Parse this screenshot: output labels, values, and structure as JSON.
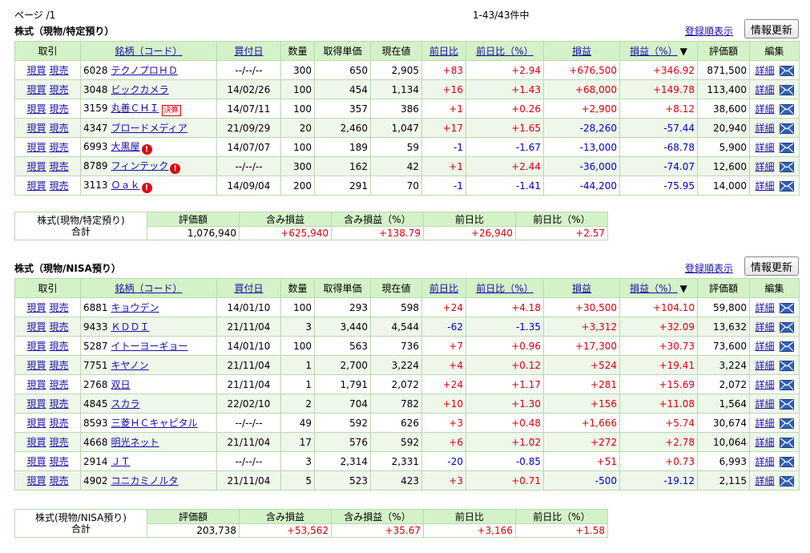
{
  "page_label": "ページ /1",
  "count_label": "1-43/43件中",
  "headers": [
    "取引",
    "銘柄（コード）",
    "買付日",
    "数量",
    "取得単価",
    "現在値",
    "前日比",
    "前日比（%）",
    "損益",
    "損益（%）",
    "評価額",
    "編集"
  ],
  "sort_mark": "▼",
  "sort_order_link": "登録順表示",
  "refresh_label": "情報更新",
  "buy_label": "現買",
  "sell_label": "現売",
  "detail_label": "詳細",
  "kessan_label": "決算",
  "warn_glyph": "!",
  "summary_headers": [
    "評価額",
    "含み損益",
    "含み損益（%）",
    "前日比",
    "前日比（%）"
  ],
  "colors": {
    "header_bg": "#d4f2c7",
    "border": "#b9d9b0",
    "even_row": "#eef7ea",
    "positive": "#e0000b",
    "negative": "#0000cc",
    "link": "#1a0dab"
  },
  "sections": [
    {
      "title": "株式（現物/特定預り）",
      "summary_label": "株式(現物/特定預り)",
      "summary_total_label": "合計",
      "summary_values": [
        "1,076,940",
        "+625,940",
        "+138.79",
        "+26,940",
        "+2.57"
      ],
      "rows": [
        {
          "code": "6028",
          "name": "テクノプロＨＤ",
          "date": "--/--/--",
          "qty": "300",
          "cost": "650",
          "price": "2,905",
          "chg": "+83",
          "chg_pct": "+2.94",
          "pl": "+676,500",
          "pl_pct": "+346.92",
          "value": "871,500",
          "warn": false,
          "kessan": false
        },
        {
          "code": "3048",
          "name": "ビックカメラ",
          "date": "14/02/26",
          "qty": "100",
          "cost": "454",
          "price": "1,134",
          "chg": "+16",
          "chg_pct": "+1.43",
          "pl": "+68,000",
          "pl_pct": "+149.78",
          "value": "113,400",
          "warn": false,
          "kessan": false
        },
        {
          "code": "3159",
          "name": "丸善ＣＨＩ",
          "date": "14/07/11",
          "qty": "100",
          "cost": "357",
          "price": "386",
          "chg": "+1",
          "chg_pct": "+0.26",
          "pl": "+2,900",
          "pl_pct": "+8.12",
          "value": "38,600",
          "warn": false,
          "kessan": true
        },
        {
          "code": "4347",
          "name": "ブロードメディア",
          "date": "21/09/29",
          "qty": "20",
          "cost": "2,460",
          "price": "1,047",
          "chg": "+17",
          "chg_pct": "+1.65",
          "pl": "-28,260",
          "pl_pct": "-57.44",
          "value": "20,940",
          "warn": false,
          "kessan": false
        },
        {
          "code": "6993",
          "name": "大黒屋",
          "date": "14/07/07",
          "qty": "100",
          "cost": "189",
          "price": "59",
          "chg": "-1",
          "chg_pct": "-1.67",
          "pl": "-13,000",
          "pl_pct": "-68.78",
          "value": "5,900",
          "warn": true,
          "kessan": false
        },
        {
          "code": "8789",
          "name": "フィンテック",
          "date": "--/--/--",
          "qty": "300",
          "cost": "162",
          "price": "42",
          "chg": "+1",
          "chg_pct": "+2.44",
          "pl": "-36,000",
          "pl_pct": "-74.07",
          "value": "12,600",
          "warn": true,
          "kessan": false
        },
        {
          "code": "3113",
          "name": "Ｏａｋ",
          "date": "14/09/04",
          "qty": "200",
          "cost": "291",
          "price": "70",
          "chg": "-1",
          "chg_pct": "-1.41",
          "pl": "-44,200",
          "pl_pct": "-75.95",
          "value": "14,000",
          "warn": true,
          "kessan": false
        }
      ]
    },
    {
      "title": "株式（現物/NISA預り）",
      "summary_label": "株式(現物/NISA預り)",
      "summary_total_label": "合計",
      "summary_values": [
        "203,738",
        "+53,562",
        "+35.67",
        "+3,166",
        "+1.58"
      ],
      "rows": [
        {
          "code": "6881",
          "name": "キョウデン",
          "date": "14/01/10",
          "qty": "100",
          "cost": "293",
          "price": "598",
          "chg": "+24",
          "chg_pct": "+4.18",
          "pl": "+30,500",
          "pl_pct": "+104.10",
          "value": "59,800",
          "warn": false,
          "kessan": false
        },
        {
          "code": "9433",
          "name": "ＫＤＤＩ",
          "date": "21/11/04",
          "qty": "3",
          "cost": "3,440",
          "price": "4,544",
          "chg": "-62",
          "chg_pct": "-1.35",
          "pl": "+3,312",
          "pl_pct": "+32.09",
          "value": "13,632",
          "warn": false,
          "kessan": false
        },
        {
          "code": "5287",
          "name": "イトーヨーギョー",
          "date": "14/01/10",
          "qty": "100",
          "cost": "563",
          "price": "736",
          "chg": "+7",
          "chg_pct": "+0.96",
          "pl": "+17,300",
          "pl_pct": "+30.73",
          "value": "73,600",
          "warn": false,
          "kessan": false
        },
        {
          "code": "7751",
          "name": "キヤノン",
          "date": "21/11/04",
          "qty": "1",
          "cost": "2,700",
          "price": "3,224",
          "chg": "+4",
          "chg_pct": "+0.12",
          "pl": "+524",
          "pl_pct": "+19.41",
          "value": "3,224",
          "warn": false,
          "kessan": false
        },
        {
          "code": "2768",
          "name": "双日",
          "date": "21/11/04",
          "qty": "1",
          "cost": "1,791",
          "price": "2,072",
          "chg": "+24",
          "chg_pct": "+1.17",
          "pl": "+281",
          "pl_pct": "+15.69",
          "value": "2,072",
          "warn": false,
          "kessan": false
        },
        {
          "code": "4845",
          "name": "スカラ",
          "date": "22/02/10",
          "qty": "2",
          "cost": "704",
          "price": "782",
          "chg": "+10",
          "chg_pct": "+1.30",
          "pl": "+156",
          "pl_pct": "+11.08",
          "value": "1,564",
          "warn": false,
          "kessan": false
        },
        {
          "code": "8593",
          "name": "三菱ＨＣキャピタル",
          "date": "--/--/--",
          "qty": "49",
          "cost": "592",
          "price": "626",
          "chg": "+3",
          "chg_pct": "+0.48",
          "pl": "+1,666",
          "pl_pct": "+5.74",
          "value": "30,674",
          "warn": false,
          "kessan": false
        },
        {
          "code": "4668",
          "name": "明光ネット",
          "date": "21/11/04",
          "qty": "17",
          "cost": "576",
          "price": "592",
          "chg": "+6",
          "chg_pct": "+1.02",
          "pl": "+272",
          "pl_pct": "+2.78",
          "value": "10,064",
          "warn": false,
          "kessan": false
        },
        {
          "code": "2914",
          "name": "ＪＴ",
          "date": "--/--/--",
          "qty": "3",
          "cost": "2,314",
          "price": "2,331",
          "chg": "-20",
          "chg_pct": "-0.85",
          "pl": "+51",
          "pl_pct": "+0.73",
          "value": "6,993",
          "warn": false,
          "kessan": false
        },
        {
          "code": "4902",
          "name": "コニカミノルタ",
          "date": "21/11/04",
          "qty": "5",
          "cost": "523",
          "price": "423",
          "chg": "+3",
          "chg_pct": "+0.71",
          "pl": "-500",
          "pl_pct": "-19.12",
          "value": "2,115",
          "warn": false,
          "kessan": false
        }
      ]
    }
  ]
}
